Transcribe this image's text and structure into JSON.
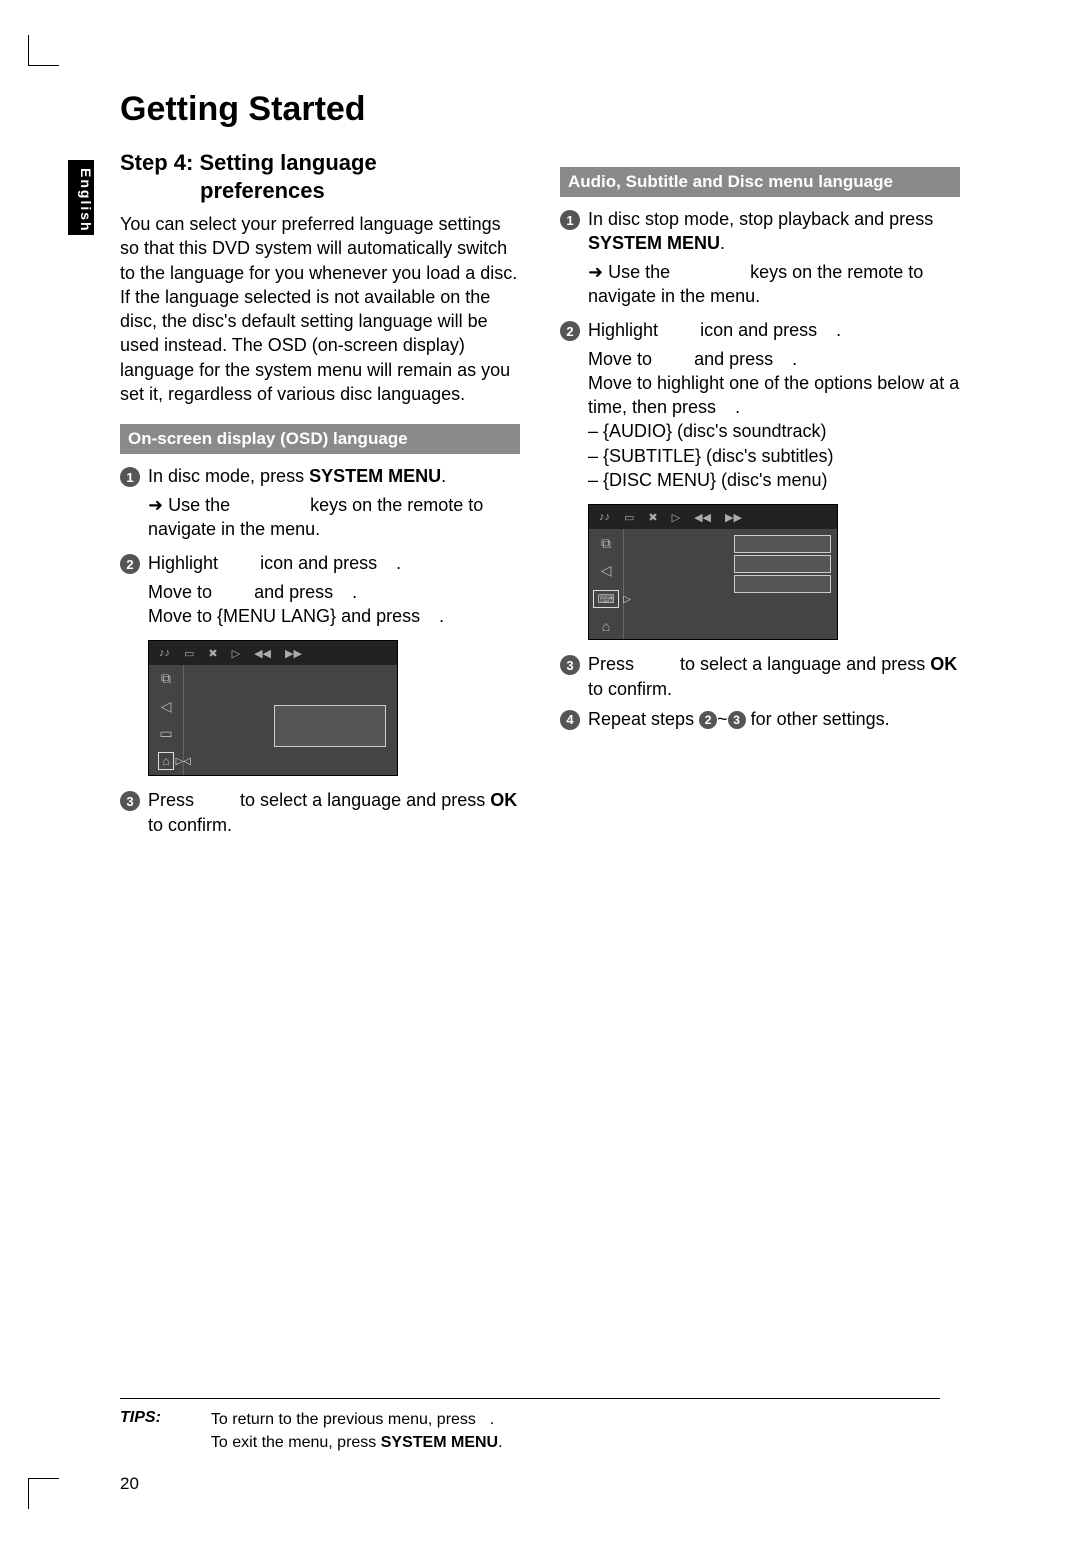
{
  "lang_tab": "English",
  "section_title": "Getting Started",
  "step_title_a": "Step 4:  Setting language",
  "step_title_b": "preferences",
  "intro": "You can select your preferred language settings so that this DVD system will automatically switch to the language for you whenever you load a disc.  If the language selected is not available on the disc, the disc's default setting language will be used instead.  The OSD (on-screen display) language for the system menu will remain as you set it, regardless of various disc languages.",
  "left": {
    "sub": "On-screen display (OSD) language",
    "s1a": "In disc mode, press ",
    "s1b": "SYSTEM MENU",
    "s1c": ".",
    "s1_arrow": "➜ Use the",
    "s1_tail": "keys on the remote to navigate in the menu.",
    "s2a": "Highlight",
    "s2b": "icon and press",
    "s2c": ".",
    "s2_l2a": "Move to",
    "s2_l2b": "and press",
    "s2_l2c": ".",
    "s2_l3a": "Move to {MENU LANG} and press",
    "s2_l3b": ".",
    "s3a": "Press",
    "s3b": "to select a language and press",
    "s3c": "OK",
    "s3d": " to confirm."
  },
  "right": {
    "sub": "Audio, Subtitle and Disc menu language",
    "s1a": "In disc stop mode, stop playback and press ",
    "s1b": "SYSTEM MENU",
    "s1c": ".",
    "s1_arrow": "➜ Use the",
    "s1_tail": "keys on the remote to navigate in the menu.",
    "s2a": "Highlight",
    "s2b": "icon and press",
    "s2c": ".",
    "s2_l2a": "Move to",
    "s2_l2b": "and press",
    "s2_l2c": ".",
    "s2_l3": "Move to highlight one of the options below at a time, then press",
    "s2_l3b": ".",
    "opt1": "–  {AUDIO} (disc's soundtrack)",
    "opt2": "–  {SUBTITLE} (disc's subtitles)",
    "opt3": "–  {DISC MENU} (disc's menu)",
    "s3a": "Press",
    "s3b": "to select a language and press",
    "s3c": "OK",
    "s3d": " to confirm.",
    "s4a": "Repeat steps ",
    "s4_n2": "2",
    "s4_mid": "~",
    "s4_n3": "3",
    "s4b": " for other settings."
  },
  "tips": {
    "label": "TIPS:",
    "line1a": "To return to the previous menu, press",
    "line1b": ".",
    "line2a": "To exit the menu, press ",
    "line2b": "SYSTEM MENU",
    "line2c": "."
  },
  "page_number": "20"
}
